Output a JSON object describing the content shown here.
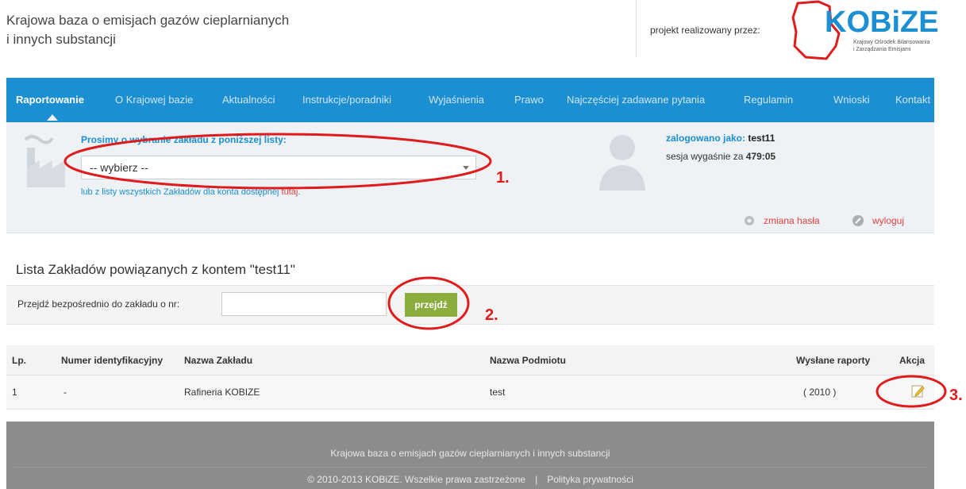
{
  "header": {
    "title_line1": "Krajowa baza o emisjach gazów cieplarnianych",
    "title_line2": "i innych substancji",
    "project_label": "projekt realizowany przez:",
    "logo": {
      "brand": "KOBiZE",
      "subtitle_line1": "Krajowy Ośrodek Bilansowania",
      "subtitle_line2": "i Zarządzania Emisjami",
      "color": "#1b8fd2",
      "accent": "#e01b1b"
    }
  },
  "nav": {
    "items": [
      {
        "label": "Raportowanie",
        "active": true
      },
      {
        "label": "O Krajowej bazie"
      },
      {
        "label": "Aktualności"
      },
      {
        "label": "Instrukcje/poradniki"
      },
      {
        "label": "Wyjaśnienia"
      },
      {
        "label": "Prawo"
      },
      {
        "label": "Najczęściej zadawane pytania"
      },
      {
        "label": "Regulamin"
      },
      {
        "label": "Wnioski"
      },
      {
        "label": "Kontakt"
      }
    ],
    "background": "#1b8fd2"
  },
  "panel": {
    "prompt": "Prosimy o wybranie zakładu z poniższej listy:",
    "select_value": "-- wybierz --",
    "alt_link_prefix": "lub z listy wszystkich Zakładów dla konta dostępnej ",
    "alt_link_here": "tutaj",
    "alt_link_suffix": ".",
    "logged_label": "zalogowano jako: ",
    "logged_user": "test11",
    "session_label": "sesja wygaśnie za ",
    "session_time": "479:05",
    "change_password": "zmiana hasła",
    "logout": "wyloguj"
  },
  "list": {
    "title": "Lista Zakładów powiązanych z kontem \"test11\"",
    "goto_label": "Przejdź bezpośrednio do zakładu o nr:",
    "goto_value": "",
    "goto_button": "przejdź"
  },
  "table": {
    "headers": [
      "Lp.",
      "Numer identyfikacyjny",
      "Nazwa Zakładu",
      "Nazwa Podmiotu",
      "Wysłane raporty",
      "Akcja"
    ],
    "rows": [
      {
        "lp": "1",
        "id": "-",
        "name": "Rafineria KOBIZE",
        "entity": "test",
        "reports": "( 2010 )"
      }
    ]
  },
  "annotations": {
    "a1": "1.",
    "a2": "2.",
    "a3": "3.",
    "color": "#e01b1b"
  },
  "footer": {
    "line1": "Krajowa baza o emisjach gazów cieplarnianych i innych substancji",
    "copyright": "© 2010-2013 KOBiZE. Wszelkie prawa zastrzeżone",
    "separator": "|",
    "privacy": "Polityka prywatności"
  }
}
